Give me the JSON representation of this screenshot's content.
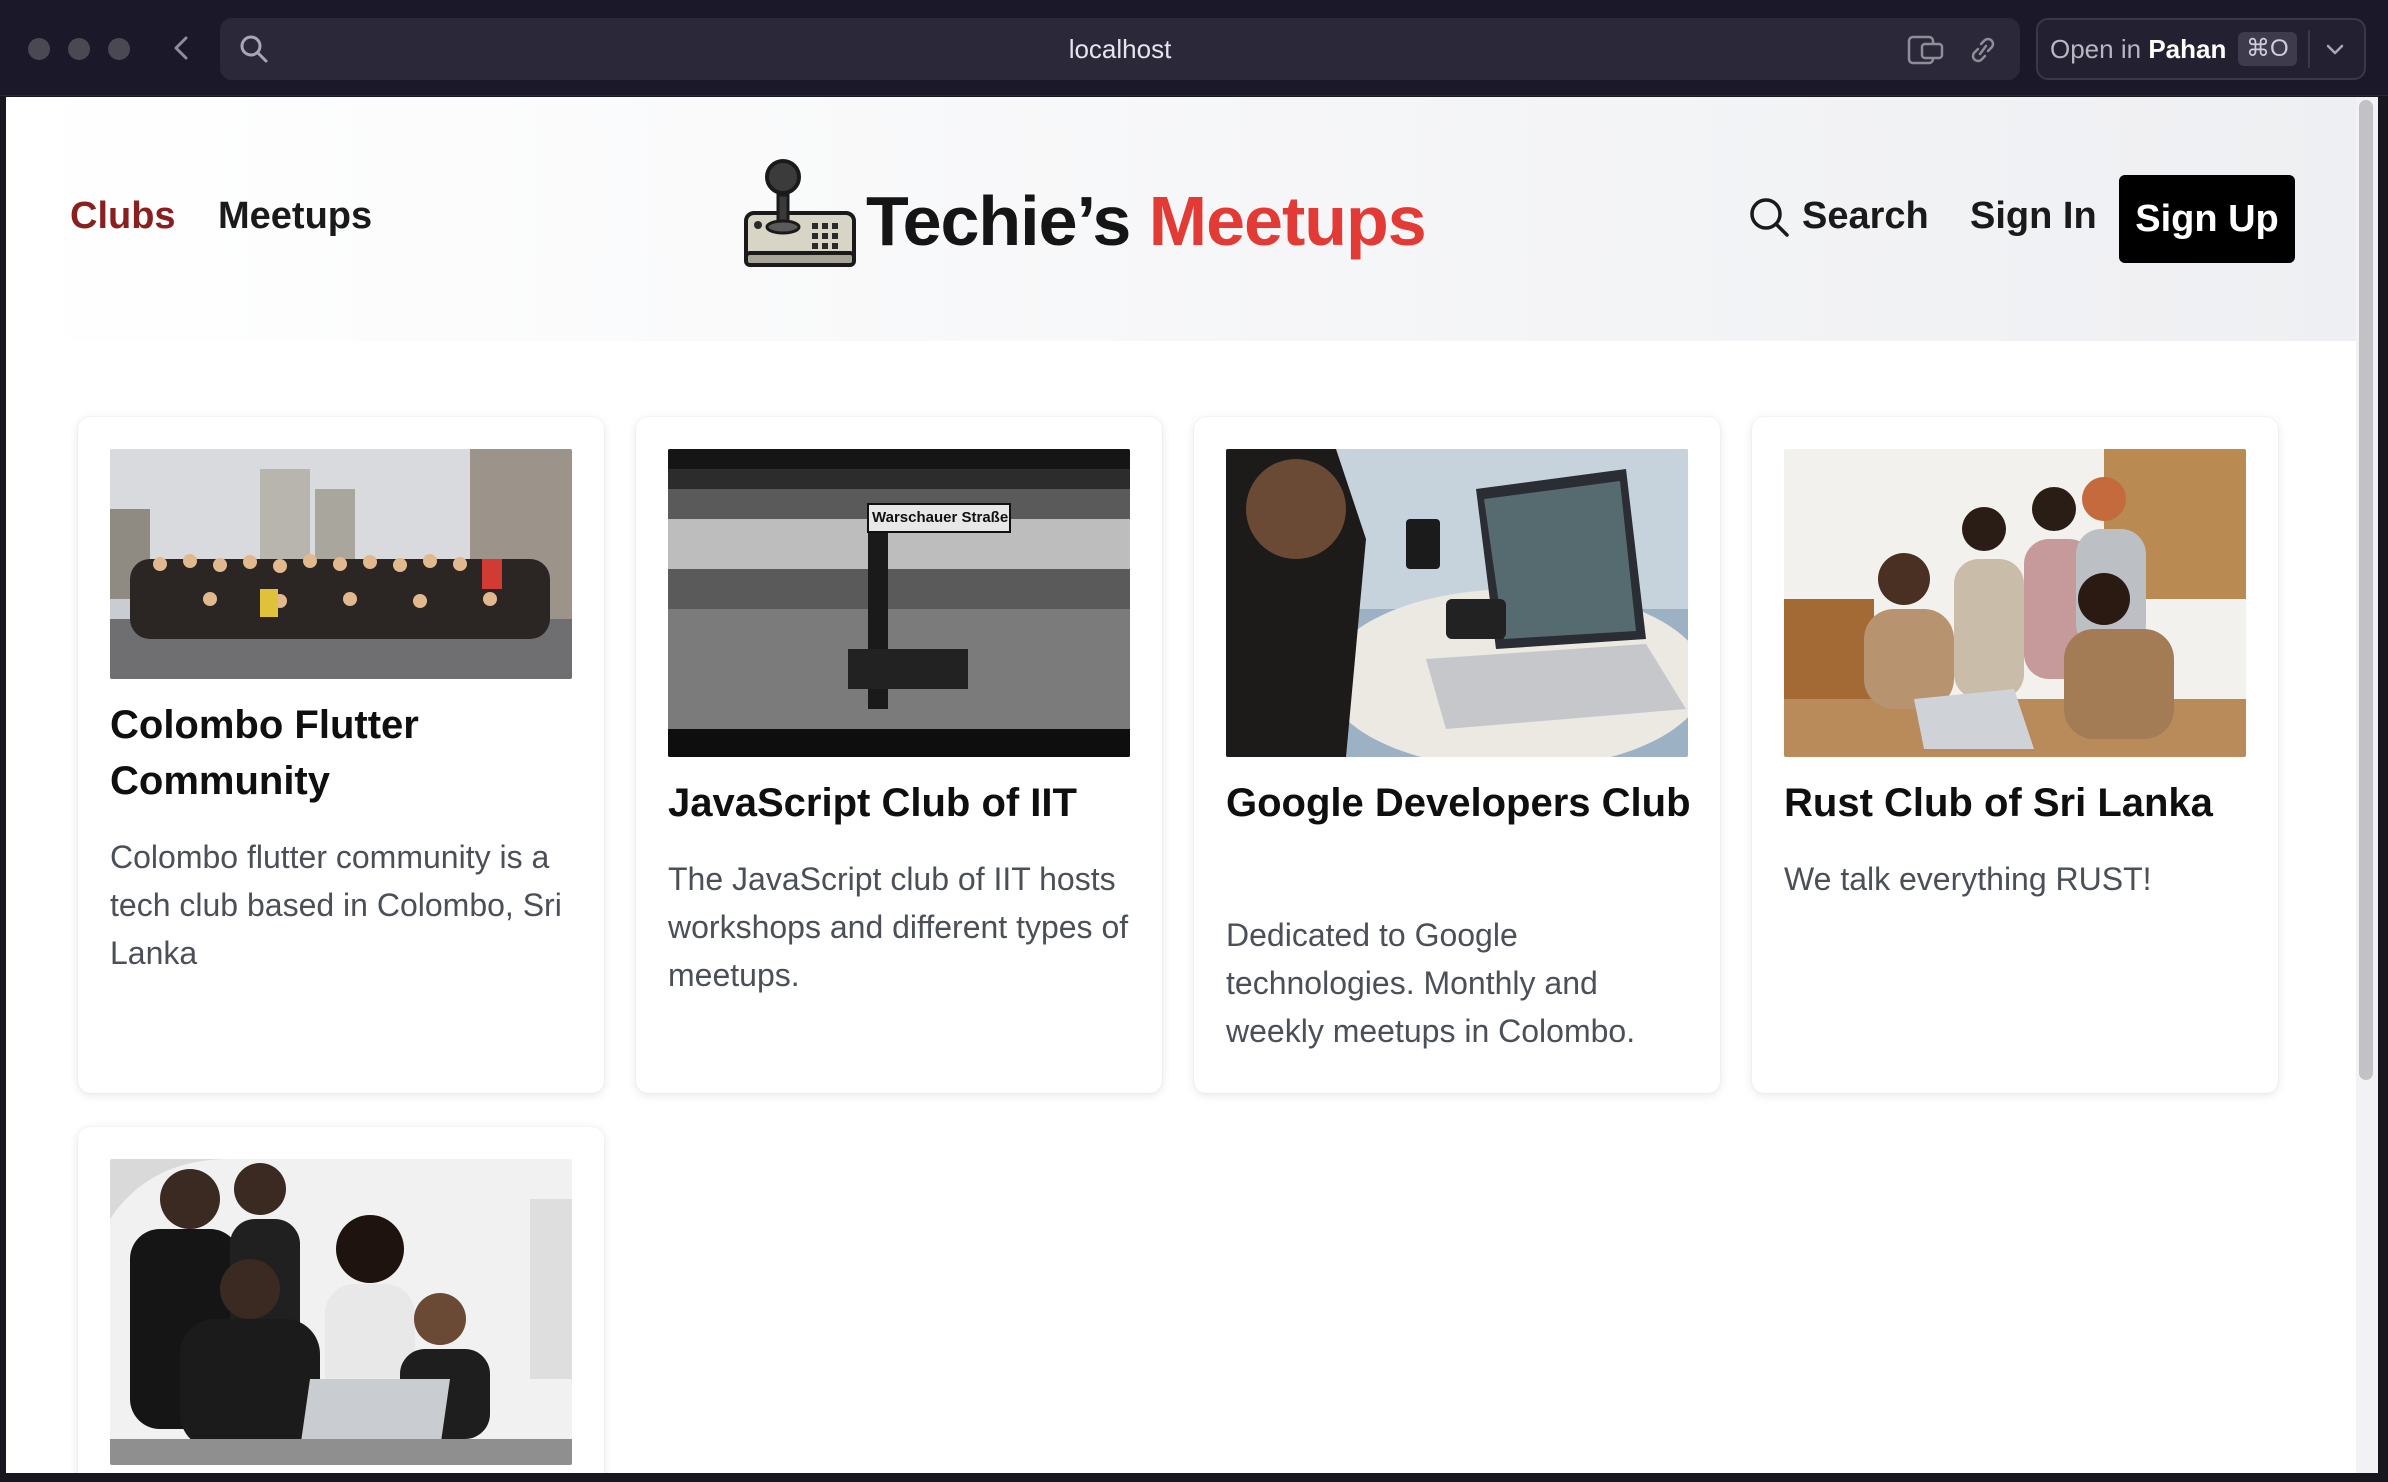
{
  "browser": {
    "url": "localhost",
    "open_in_prefix": "Open in",
    "open_in_app": "Pahan",
    "shortcut": "⌘O"
  },
  "nav": {
    "clubs": "Clubs",
    "meetups": "Meetups",
    "search": "Search",
    "sign_in": "Sign In",
    "sign_up": "Sign Up"
  },
  "logo": {
    "part1": "Techie’s",
    "part2": "Meetups"
  },
  "colors": {
    "brand_red": "#e23a35",
    "active_nav": "#8a1f1f",
    "primary_button": "#000000"
  },
  "clubs": [
    {
      "title": "Colombo Flutter Community",
      "description": "Colombo flutter community is a tech club based in Colombo, Sri Lanka",
      "image": "group-photo-street"
    },
    {
      "title": "JavaScript Club of IIT",
      "description": "The JavaScript club of IIT hosts workshops and different types of meetups.",
      "image": "train-station-bw",
      "sign": "Warschauer Straße"
    },
    {
      "title": "Google Developers Club",
      "description": "Dedicated to Google technologies. Monthly and weekly meetups in Colombo.",
      "image": "person-laptop-cafe"
    },
    {
      "title": "Rust Club of Sri Lanka",
      "description": "We talk everything RUST!",
      "image": "team-around-laptop"
    },
    {
      "title": "",
      "description": "",
      "image": "team-working-laptop"
    }
  ]
}
